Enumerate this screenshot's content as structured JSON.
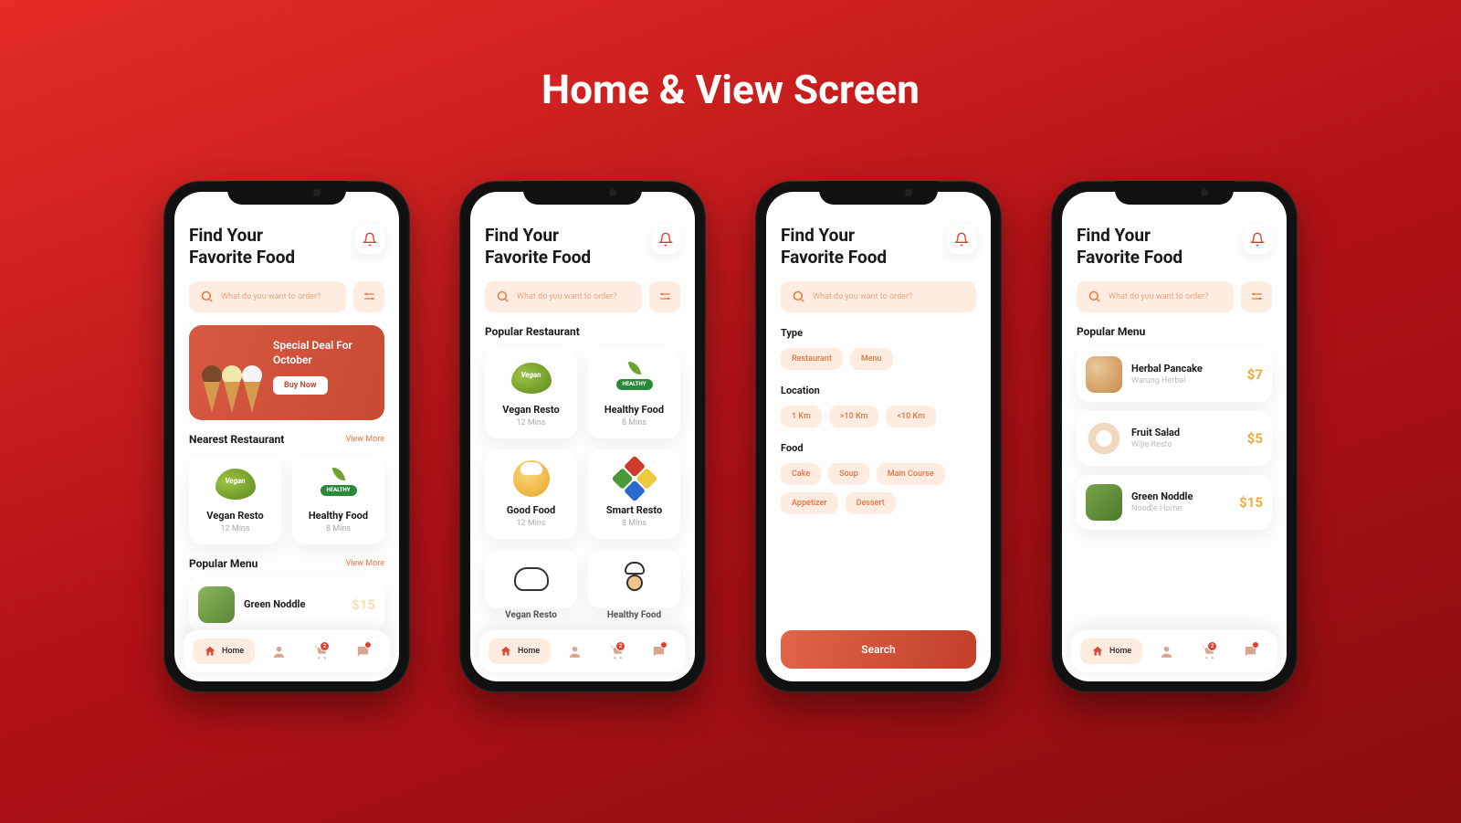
{
  "page_title": "Home & View Screen",
  "header": {
    "line1": "Find Your",
    "line2": "Favorite Food"
  },
  "search": {
    "placeholder": "What do you want to order?"
  },
  "promo": {
    "text": "Special Deal For October",
    "button": "Buy Now"
  },
  "sections": {
    "nearest": "Nearest Restaurant",
    "popular_restaurant": "Popular Restaurant",
    "popular_menu": "Popular Menu",
    "view_more": "View More"
  },
  "restaurants": [
    {
      "name": "Vegan Resto",
      "time": "12 Mins"
    },
    {
      "name": "Healthy Food",
      "time": "8 Mins"
    },
    {
      "name": "Good Food",
      "time": "12 Mins"
    },
    {
      "name": "Smart Resto",
      "time": "8 Mins"
    },
    {
      "name": "Vegan Resto",
      "time": ""
    },
    {
      "name": "Healthy Food",
      "time": ""
    }
  ],
  "menu_items": [
    {
      "name": "Green Noddle",
      "sub": "",
      "price": "$15"
    },
    {
      "name": "Herbal Pancake",
      "sub": "Warung Herbal",
      "price": "$7"
    },
    {
      "name": "Fruit Salad",
      "sub": "Wijie Resto",
      "price": "$5"
    },
    {
      "name": "Green Noddle",
      "sub": "Noodle Home",
      "price": "$15"
    }
  ],
  "filters": {
    "type_label": "Type",
    "type": [
      "Restaurant",
      "Menu"
    ],
    "location_label": "Location",
    "location": [
      "1 Km",
      ">10 Km",
      "<10 Km"
    ],
    "food_label": "Food",
    "food": [
      "Cake",
      "Soup",
      "Main Course",
      "Appetizer",
      "Dessert"
    ],
    "search_button": "Search"
  },
  "nav": {
    "home": "Home",
    "cart_badge": "2"
  }
}
